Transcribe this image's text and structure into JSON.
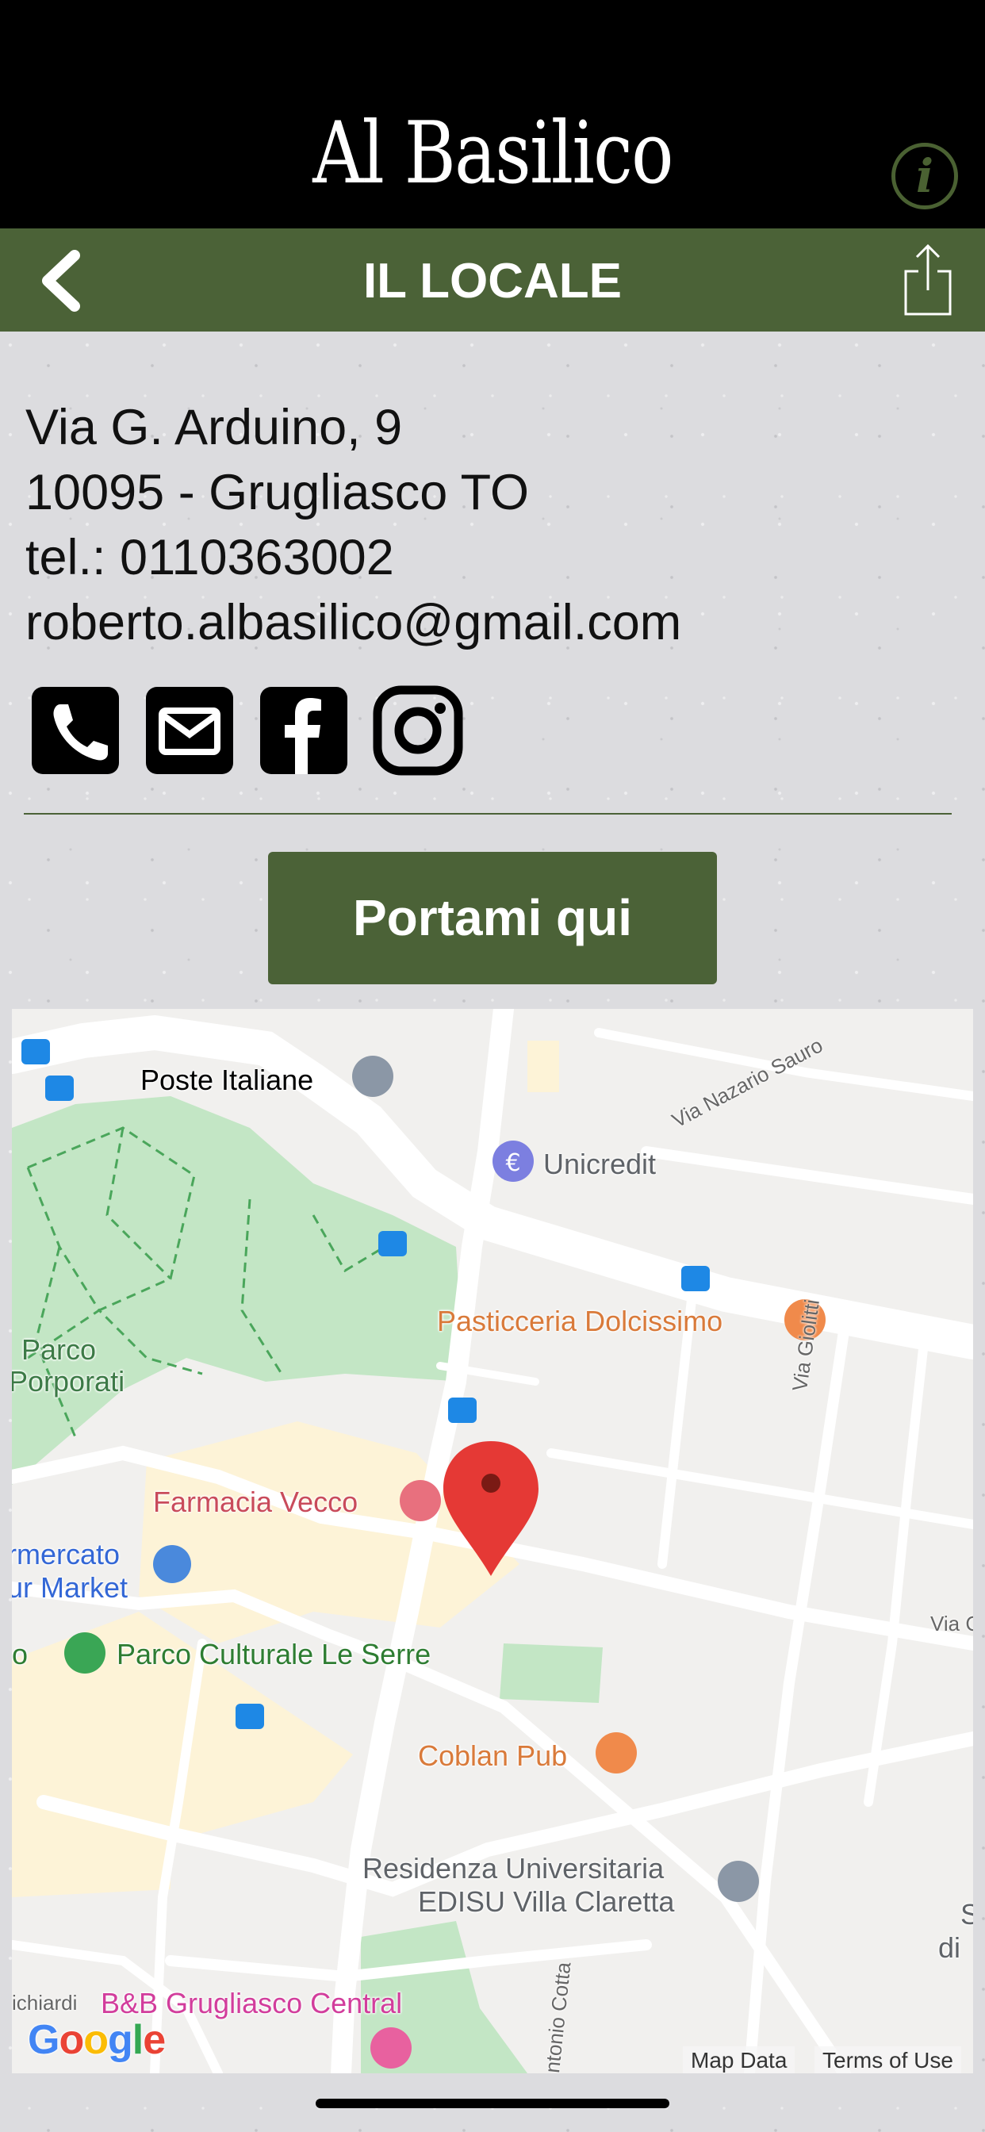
{
  "header": {
    "brand": "Al Basilico",
    "info_glyph": "i"
  },
  "navbar": {
    "title": "IL LOCALE",
    "back_icon": "chevron-left-icon",
    "share_icon": "share-icon"
  },
  "contact": {
    "address_line1": "Via G. Arduino, 9",
    "address_line2": "10095 - Grugliasco TO",
    "phone": "tel.: 0110363002",
    "email": "roberto.albasilico@gmail.com"
  },
  "social": [
    "phone-icon",
    "envelope-icon",
    "facebook-icon",
    "instagram-icon"
  ],
  "action": {
    "label": "Portami qui"
  },
  "map": {
    "pois": [
      {
        "name": "poste",
        "label": "Poste Italiane",
        "color": "#5f6368"
      },
      {
        "name": "unicredit",
        "label": "Unicredit",
        "color": "#5f6368"
      },
      {
        "name": "pasticceria",
        "label": "Pasticceria Dolcissimo",
        "color": "#d97a3a"
      },
      {
        "name": "parco-porporati-1",
        "label": "Parco",
        "color": "#3c7a46"
      },
      {
        "name": "parco-porporati-2",
        "label": "Porporati",
        "color": "#3c7a46"
      },
      {
        "name": "farmacia",
        "label": "Farmacia Vecco",
        "color": "#c94b5b"
      },
      {
        "name": "supermarket-1",
        "label": "rmercato",
        "color": "#3367d6"
      },
      {
        "name": "supermarket-2",
        "label": "ur Market",
        "color": "#3367d6"
      },
      {
        "name": "parco-serre",
        "label": "Parco Culturale Le Serre",
        "color": "#2e7d32"
      },
      {
        "name": "coblan",
        "label": "Coblan Pub",
        "color": "#d97a3a"
      },
      {
        "name": "residenza-1",
        "label": "Residenza Universitaria",
        "color": "#5f6368"
      },
      {
        "name": "residenza-2",
        "label": "EDISU Villa Claretta",
        "color": "#5f6368"
      },
      {
        "name": "bb",
        "label": "B&B Grugliasco Central",
        "color": "#d23d9c"
      },
      {
        "name": "left-o",
        "label": "o",
        "color": "#2e7d32"
      },
      {
        "name": "edge-s",
        "label": "S",
        "color": "#5f6368"
      },
      {
        "name": "edge-di",
        "label": "di",
        "color": "#5f6368"
      }
    ],
    "streets": [
      {
        "name": "via-nazario-sauro",
        "label": "Via Nazario Sauro"
      },
      {
        "name": "via-giolitti",
        "label": "Via Giolitti"
      },
      {
        "name": "via-c",
        "label": "Via C"
      },
      {
        "name": "antonio-cotta",
        "label": "ntonio Cotta"
      },
      {
        "name": "ichiardi",
        "label": "ichiardi"
      }
    ],
    "google": "Google",
    "map_data": "Map Data",
    "terms": "Terms of Use"
  },
  "colors": {
    "accent": "#4b6237",
    "pin": "#e53935"
  }
}
